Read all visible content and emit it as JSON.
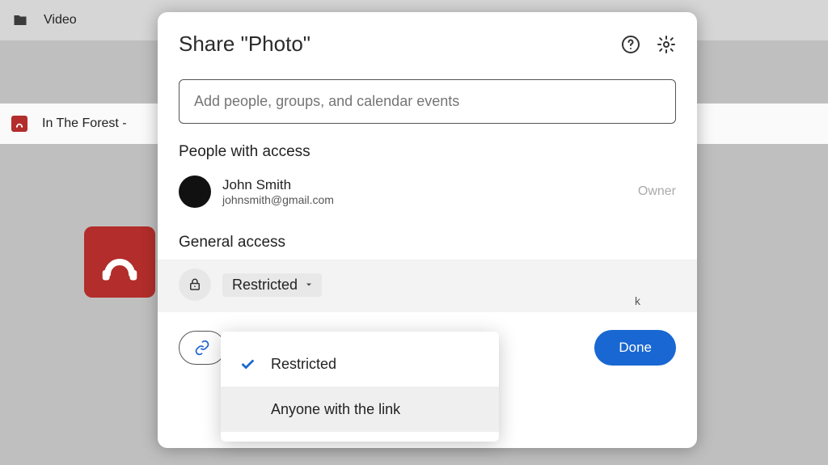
{
  "background": {
    "rows": [
      {
        "label": "Video"
      },
      {
        "label": "In The Forest - "
      }
    ]
  },
  "dialog": {
    "title": "Share \"Photo\"",
    "addInputPlaceholder": "Add people, groups, and calendar events",
    "peopleSectionLabel": "People with access",
    "person": {
      "name": "John Smith",
      "email": "johnsmith@gmail.com",
      "role": "Owner"
    },
    "generalSectionLabel": "General access",
    "generalDropdownSelected": "Restricted",
    "hintLetter": "k",
    "doneLabel": "Done"
  },
  "dropdown": {
    "options": [
      {
        "label": "Restricted",
        "selected": true
      },
      {
        "label": "Anyone with the link",
        "selected": false
      }
    ]
  }
}
